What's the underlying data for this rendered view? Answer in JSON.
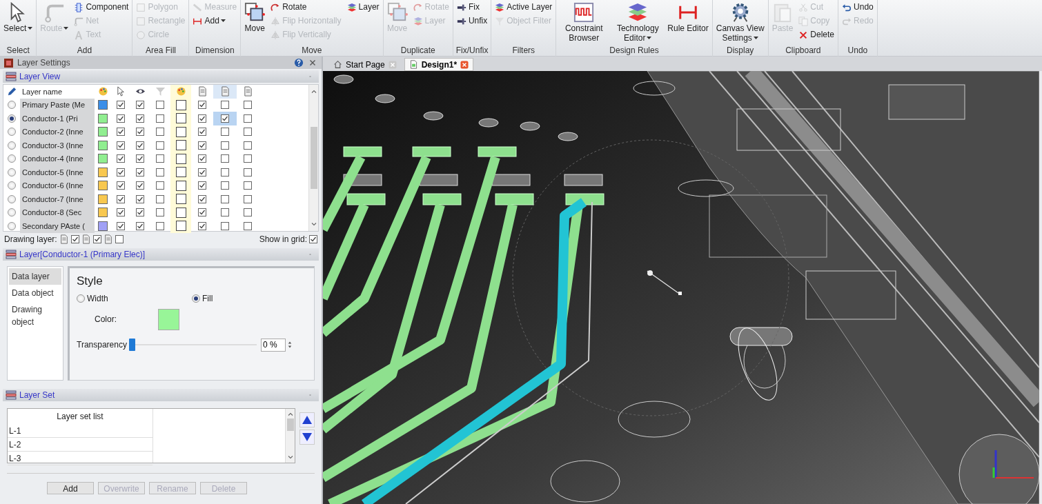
{
  "ribbon": {
    "groups": [
      {
        "label": "Select",
        "items": [
          {
            "label": "Select",
            "kind": "large",
            "disabled": false,
            "has_menu": true
          }
        ]
      },
      {
        "label": "Add",
        "items": [
          {
            "label": "Route",
            "kind": "large",
            "disabled": true,
            "has_menu": true
          },
          {
            "label": "Component",
            "kind": "small",
            "disabled": false,
            "has_menu": false
          },
          {
            "label": "Net",
            "kind": "small",
            "disabled": true,
            "has_menu": false
          },
          {
            "label": "Text",
            "kind": "small",
            "disabled": true,
            "has_menu": false
          }
        ]
      },
      {
        "label": "Area Fill",
        "items": [
          {
            "label": "Polygon",
            "kind": "small",
            "disabled": true,
            "has_menu": false
          },
          {
            "label": "Rectangle",
            "kind": "small",
            "disabled": true,
            "has_menu": false
          },
          {
            "label": "Circle",
            "kind": "small",
            "disabled": true,
            "has_menu": false
          }
        ]
      },
      {
        "label": "Dimension",
        "items": [
          {
            "label": "Measure",
            "kind": "small",
            "disabled": true,
            "has_menu": false
          },
          {
            "label": "Add",
            "kind": "small",
            "disabled": false,
            "has_menu": true
          }
        ]
      },
      {
        "label": "Move",
        "items": [
          {
            "label": "Move",
            "kind": "large",
            "disabled": false,
            "has_menu": false
          },
          {
            "label": "Rotate",
            "kind": "small",
            "disabled": false,
            "has_menu": false
          },
          {
            "label": "Flip Horizontally",
            "kind": "small",
            "disabled": true,
            "has_menu": false
          },
          {
            "label": "Flip Vertically",
            "kind": "small",
            "disabled": true,
            "has_menu": false
          },
          {
            "label": "Layer",
            "kind": "small",
            "disabled": false,
            "has_menu": false
          }
        ]
      },
      {
        "label": "Duplicate",
        "items": [
          {
            "label": "Move",
            "kind": "large",
            "disabled": true,
            "has_menu": false
          },
          {
            "label": "Rotate",
            "kind": "small",
            "disabled": true,
            "has_menu": false
          },
          {
            "label": "Layer",
            "kind": "small",
            "disabled": true,
            "has_menu": false
          }
        ]
      },
      {
        "label": "Fix/Unfix",
        "items": [
          {
            "label": "Fix",
            "kind": "small",
            "disabled": false,
            "has_menu": false
          },
          {
            "label": "Unfix",
            "kind": "small",
            "disabled": false,
            "has_menu": false
          }
        ]
      },
      {
        "label": "Filters",
        "items": [
          {
            "label": "Active Layer",
            "kind": "small",
            "disabled": false,
            "has_menu": false
          },
          {
            "label": "Object Filter",
            "kind": "small",
            "disabled": true,
            "has_menu": false
          }
        ]
      },
      {
        "label": "Design Rules",
        "items": [
          {
            "label": "Constraint Browser",
            "kind": "large",
            "disabled": false,
            "has_menu": false
          },
          {
            "label": "Technology Editor",
            "kind": "large",
            "disabled": false,
            "has_menu": true
          },
          {
            "label": "Rule Editor",
            "kind": "large",
            "disabled": false,
            "has_menu": false
          }
        ]
      },
      {
        "label": "Display",
        "items": [
          {
            "label": "Canvas View Settings",
            "kind": "large",
            "disabled": false,
            "has_menu": true
          }
        ]
      },
      {
        "label": "Clipboard",
        "items": [
          {
            "label": "Paste",
            "kind": "large",
            "disabled": true,
            "has_menu": false
          },
          {
            "label": "Cut",
            "kind": "small",
            "disabled": true,
            "has_menu": false
          },
          {
            "label": "Copy",
            "kind": "small",
            "disabled": true,
            "has_menu": false
          },
          {
            "label": "Delete",
            "kind": "small",
            "disabled": false,
            "has_menu": false
          }
        ]
      },
      {
        "label": "Undo",
        "items": [
          {
            "label": "Undo",
            "kind": "small",
            "disabled": false,
            "has_menu": false
          },
          {
            "label": "Redo",
            "kind": "small",
            "disabled": true,
            "has_menu": false
          }
        ]
      }
    ]
  },
  "panel": {
    "title": "Layer Settings",
    "layer_view": {
      "title": "Layer View",
      "name_header": "Layer name",
      "rows": [
        {
          "name": "Primary Paste (Me",
          "selected": false,
          "color": "#3b8ee8",
          "checks": [
            true,
            true,
            false,
            true,
            false,
            false
          ]
        },
        {
          "name": "Conductor-1 (Pri",
          "selected": true,
          "color": "#90ee90",
          "checks": [
            true,
            true,
            false,
            true,
            true,
            false
          ]
        },
        {
          "name": "Conductor-2 (Inne",
          "selected": false,
          "color": "#90ee90",
          "checks": [
            true,
            true,
            false,
            true,
            false,
            false
          ]
        },
        {
          "name": "Conductor-3 (Inne",
          "selected": false,
          "color": "#90ee90",
          "checks": [
            true,
            true,
            false,
            true,
            false,
            false
          ]
        },
        {
          "name": "Conductor-4 (Inne",
          "selected": false,
          "color": "#90ee90",
          "checks": [
            true,
            true,
            false,
            true,
            false,
            false
          ]
        },
        {
          "name": "Conductor-5 (Inne",
          "selected": false,
          "color": "#f8c850",
          "checks": [
            true,
            true,
            false,
            true,
            false,
            false
          ]
        },
        {
          "name": "Conductor-6 (Inne",
          "selected": false,
          "color": "#f8c850",
          "checks": [
            true,
            true,
            false,
            true,
            false,
            false
          ]
        },
        {
          "name": "Conductor-7 (Inne",
          "selected": false,
          "color": "#f8c850",
          "checks": [
            true,
            true,
            false,
            true,
            false,
            false
          ]
        },
        {
          "name": "Conductor-8 (Sec",
          "selected": false,
          "color": "#f8c850",
          "checks": [
            true,
            true,
            false,
            true,
            false,
            false
          ]
        },
        {
          "name": "Secondary PAste (",
          "selected": false,
          "color": "#a0a0f5",
          "checks": [
            true,
            true,
            false,
            true,
            false,
            false
          ]
        }
      ],
      "drawing_layer": {
        "label": "Drawing layer:",
        "checks": [
          true,
          true,
          false
        ]
      },
      "show_in_grid": {
        "label": "Show in grid:",
        "checked": true
      }
    },
    "layer": {
      "title": "Layer[Conductor-1 (Primary Elec)]",
      "nav": [
        {
          "label": "Data layer",
          "selected": true
        },
        {
          "label": "Data object",
          "selected": false
        },
        {
          "label": "Drawing object",
          "selected": false
        }
      ],
      "style_title": "Style",
      "modes": [
        {
          "label": "Width",
          "selected": false
        },
        {
          "label": "Fill",
          "selected": true
        }
      ],
      "color_label": "Color:",
      "color": "#98f598",
      "transparency": {
        "label": "Transparency",
        "level": 0,
        "value": "0 %"
      }
    },
    "layer_set": {
      "title": "Layer Set",
      "list_header": "Layer set list",
      "items": [
        "L-1",
        "L-2",
        "L-3"
      ],
      "buttons": [
        {
          "label": "Add",
          "disabled": false
        },
        {
          "label": "Overwrite",
          "disabled": true
        },
        {
          "label": "Rename",
          "disabled": true
        },
        {
          "label": "Delete",
          "disabled": true
        }
      ]
    }
  },
  "tabs": [
    {
      "label": "Start Page",
      "selected": false
    },
    {
      "label": "Design1*",
      "selected": true
    }
  ]
}
